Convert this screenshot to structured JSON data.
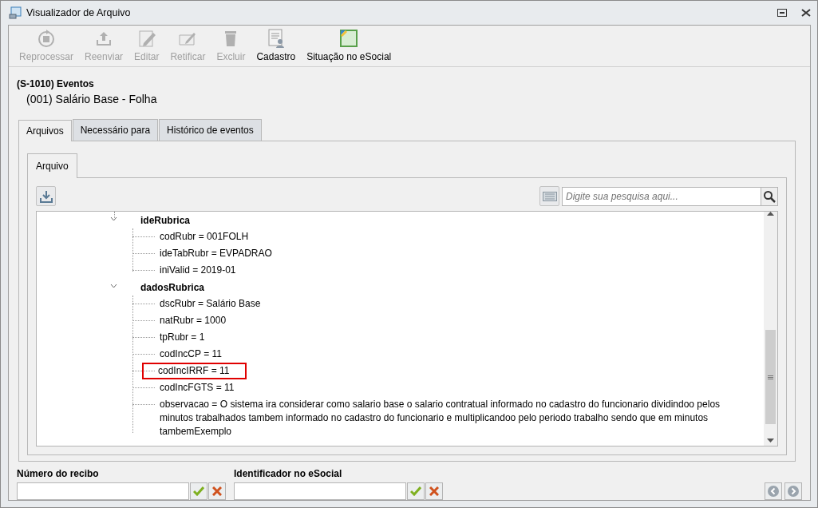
{
  "window": {
    "title": "Visualizador de Arquivo"
  },
  "toolbar": [
    {
      "kind": "reprocess",
      "label": "Reprocessar",
      "disabled": true
    },
    {
      "kind": "upload",
      "label": "Reenviar",
      "disabled": true
    },
    {
      "kind": "edit",
      "label": "Editar",
      "disabled": true
    },
    {
      "kind": "rectify",
      "label": "Retificar",
      "disabled": true
    },
    {
      "kind": "delete",
      "label": "Excluir",
      "disabled": true
    },
    {
      "kind": "register",
      "label": "Cadastro",
      "disabled": false
    },
    {
      "kind": "status",
      "label": "Situação no eSocial",
      "disabled": false
    }
  ],
  "record": {
    "event": "(S-1010) Eventos",
    "name": "(001) Salário Base - Folha"
  },
  "tabs": [
    {
      "label": "Arquivos",
      "selected": true
    },
    {
      "label": "Necessário para",
      "selected": false
    },
    {
      "label": "Histórico de eventos",
      "selected": false
    }
  ],
  "inner_tabs": [
    {
      "label": "Arquivo",
      "selected": true
    }
  ],
  "search": {
    "placeholder": "Digite sua pesquisa aqui..."
  },
  "tree": [
    {
      "label": "ideRubrica",
      "expanded": true,
      "children": [
        {
          "label": "codRubr = 001FOLH",
          "highlighted": false
        },
        {
          "label": "ideTabRubr = EVPADRAO",
          "highlighted": false
        },
        {
          "label": "iniValid = 2019-01",
          "highlighted": false
        }
      ]
    },
    {
      "label": "dadosRubrica",
      "expanded": true,
      "children": [
        {
          "label": "dscRubr = Salário Base",
          "highlighted": false
        },
        {
          "label": "natRubr = 1000",
          "highlighted": false
        },
        {
          "label": "tpRubr = 1",
          "highlighted": false
        },
        {
          "label": "codIncCP = 11",
          "highlighted": false
        },
        {
          "label": "codIncIRRF = 11",
          "highlighted": true
        },
        {
          "label": "codIncFGTS = 11",
          "highlighted": false
        },
        {
          "label": "observacao = O sistema ira considerar como salario base o salario contratual informado no cadastro do funcionario dividindoo pelos minutos trabalhados tambem informado no cadastro do funcionario e multiplicandoo pelo periodo trabalho sendo que em minutos tambemExemplo",
          "highlighted": false
        }
      ]
    }
  ],
  "fields": [
    {
      "label": "Número do recibo"
    },
    {
      "label": "Identificador no eSocial"
    }
  ]
}
